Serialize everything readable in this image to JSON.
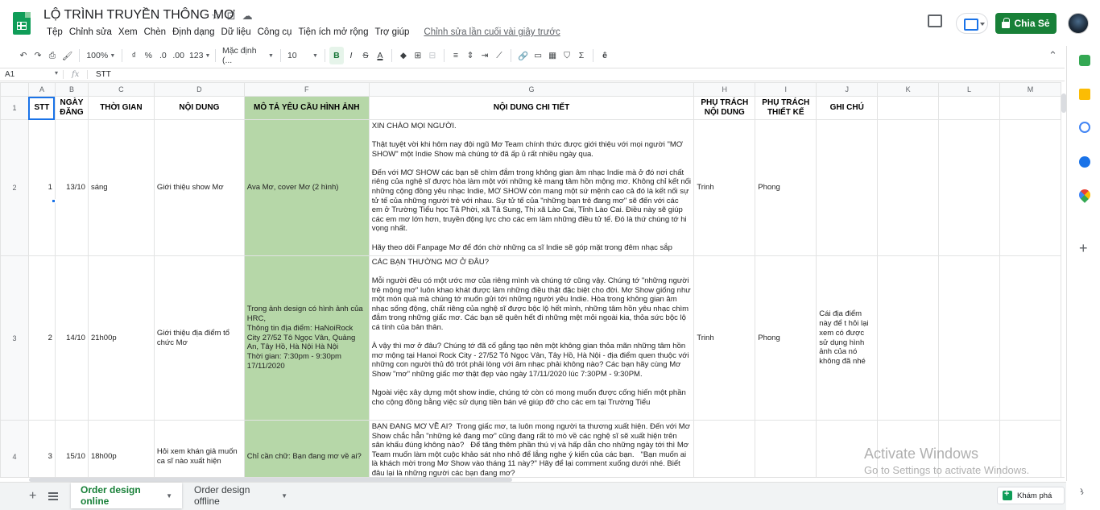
{
  "document": {
    "title": "LỘ TRÌNH TRUYỀN THÔNG MƠ",
    "menu": [
      "Tệp",
      "Chỉnh sửa",
      "Xem",
      "Chèn",
      "Định dạng",
      "Dữ liệu",
      "Công cụ",
      "Tiện ích mở rộng",
      "Trợ giúp"
    ],
    "last_edit": "Chỉnh sửa lần cuối vài giây trước",
    "share_label": "Chia Sẻ"
  },
  "toolbar": {
    "zoom": "100%",
    "currency": "₫",
    "percent": "%",
    "dec_decrease": ".0",
    "dec_increase": ".00",
    "format_more": "123",
    "font": "Mặc định (...",
    "font_size": "10",
    "bold": "B",
    "italic": "I",
    "strike": "S",
    "text_color": "A",
    "input_tools": "ê"
  },
  "formula_bar": {
    "cell_ref": "A1",
    "fx": "fx",
    "value": "STT"
  },
  "columns": [
    "A",
    "B",
    "C",
    "D",
    "E",
    "F",
    "G",
    "H",
    "I",
    "J",
    "K",
    "L",
    "M"
  ],
  "rows": [
    {
      "row_num": "1",
      "cells": {
        "A": "STT",
        "B": "NGÀY ĐĂNG",
        "C": "THỜI GIAN",
        "D": "NỘI DUNG",
        "F": "MÔ TẢ YÊU CẦU HÌNH ẢNH",
        "G": "NỘI DUNG CHI TIẾT",
        "H": "PHỤ TRÁCH NỘI DUNG",
        "I": "PHỤ TRÁCH THIẾT KẾ",
        "J": "GHI CHÚ"
      }
    },
    {
      "row_num": "2",
      "cells": {
        "A": "1",
        "B": "13/10",
        "C": "sáng",
        "D": "Giới thiệu show Mơ",
        "F": "Ava Mơ, cover Mơ (2 hình)",
        "G": "XIN CHÀO MỌI NGƯỜI.\n\nThật tuyệt vời khi hôm nay đội ngũ Mơ Team chính thức được giới thiệu với mọi người \"MƠ SHOW\" một Indie Show mà chúng tớ đã ấp ủ rất nhiều ngày qua.\n\nĐến với MƠ SHOW các bạn sẽ chìm đắm trong không gian âm nhạc Indie mà ở đó nơi chất riêng của nghệ sĩ được hòa làm một với những kẻ mang tâm hồn mộng mơ. Không chỉ kết nối những cộng đồng yêu nhạc Indie, MƠ SHOW còn mang một sứ mệnh cao cả đó là kết nối sự tử tế của những người trẻ với nhau. Sự tử tế của \"những bạn trẻ đang mơ\" sẽ đến với các em ở Trường Tiểu học Tả Phời, xã Tả Sung, Thị xã Lào Cai, Tỉnh Lào Cai. Điều này sẽ giúp các em mơ lớn hơn, truyền động lực cho các em làm những điều tử tế. Đó là thứ chúng tớ hi vọng nhất.\n\nHãy theo dõi Fanpage Mơ để đón chờ những ca sĩ Indie sẽ góp mặt trong đêm nhạc sắp",
        "H": "Trinh",
        "I": "Phong",
        "J": ""
      }
    },
    {
      "row_num": "3",
      "cells": {
        "A": "2",
        "B": "14/10",
        "C": "21h00p",
        "D": "Giới thiệu địa điểm tổ chức Mơ",
        "F": "Trong ảnh design có hình ảnh của HRC,\nThông tin địa điểm: HaNoiRock City 27/52 Tô Ngọc Vân, Quảng An, Tây Hồ, Hà Nội Hà Nội\nThời gian: 7:30pm - 9:30pm 17/11/2020",
        "G": "CÁC BẠN THƯỜNG MƠ Ở ĐÂU?\n\nMỗi người đều có một ước mơ của riêng mình và chúng tớ cũng vậy. Chúng tớ \"những người trẻ mộng mơ\" luôn khao khát được làm những điều thật đặc biệt cho đời. Mơ Show giống như một món quà mà chúng tớ muốn gửi tới những người yêu Indie. Hòa trong không gian âm nhạc sống động, chất riêng của nghệ sĩ được bộc lộ hết mình, những tâm hồn yêu nhạc chìm đắm trong những giấc mơ. Các bạn sẽ quên hết đi những mệt mỏi ngoài kia, thỏa sức bộc lộ cá tính của bản thân.\n\nÀ vậy thì mơ ở đâu? Chúng tớ đã cố gắng tạo nên một không gian thỏa mãn những tâm hồn mơ mộng tại Hanoi Rock City - 27/52 Tô Ngọc Vân, Tây Hồ, Hà Nội - địa điểm quen thuộc với những con người thủ đô trót phải lòng với âm nhạc phải không nào? Các bạn hãy cùng Mơ Show \"mơ\" những giấc mơ thật đẹp vào ngày 17/11/2020 lúc 7:30PM - 9:30PM.\n\nNgoài việc xây dựng một show indie, chúng tớ còn có mong muốn được cống hiến một phần cho cộng đồng bằng việc sử dụng tiền bán vé giúp đỡ cho các em tại Trường Tiểu",
        "H": "Trinh",
        "I": "Phong",
        "J": "Cái địa điểm này để t hỏi lại xem có được sử dụng hình ảnh của nó không đã nhé"
      }
    },
    {
      "row_num": "4",
      "cells": {
        "A": "3",
        "B": "15/10",
        "C": "18h00p",
        "D": "Hỏi xem khán giả muốn ca sĩ nào xuất hiện",
        "F": "Chỉ cần chữ: Bạn đang mơ về ai?",
        "G": "BẠN ĐANG MƠ VỀ AI?  Trong giấc mơ, ta luôn mong người ta thương xuất hiện. Đến với Mơ Show chắc hẳn \"những kẻ đang mơ\" cũng đang rất tò mò về các nghệ sĩ sẽ xuất hiện trên sân khấu đúng không nào?   Để tăng thêm phần thú vị và hấp dẫn cho những ngày tới thì Mơ Team muốn làm một cuộc khảo sát nho nhỏ để lắng nghe ý kiến của các bạn.   \"Bạn muốn ai là khách mời trong Mơ Show vào tháng 11 này?\" Hãy để lại comment xuống dưới nhé. Biết đâu lại là những người các bạn đang mơ?",
        "H": "",
        "I": "",
        "J": ""
      }
    }
  ],
  "sheet_tabs": [
    {
      "label": "Order design online",
      "active": true
    },
    {
      "label": "Order design offline",
      "active": false
    }
  ],
  "explore_label": "Khám phá",
  "watermark": {
    "title": "Activate Windows",
    "subtitle": "Go to Settings to activate Windows."
  },
  "colors": {
    "accent_green": "#188038",
    "cell_green": "#b6d7a8",
    "selection_blue": "#1a73e8"
  }
}
